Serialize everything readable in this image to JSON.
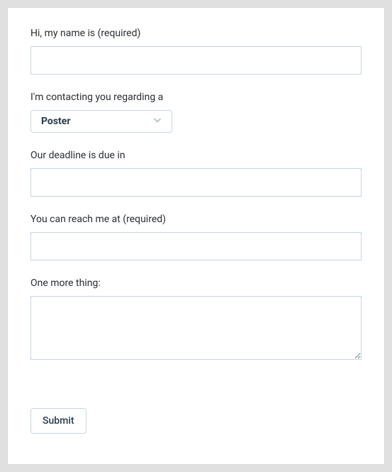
{
  "form": {
    "fields": {
      "name": {
        "label": "Hi, my name is (required)",
        "value": ""
      },
      "regarding": {
        "label": "I'm contacting you regarding a",
        "selected": "Poster"
      },
      "deadline": {
        "label": "Our deadline is due in",
        "value": ""
      },
      "contact": {
        "label": "You can reach me at (required)",
        "value": ""
      },
      "more": {
        "label": "One more thing:",
        "value": ""
      }
    },
    "submit_label": "Submit"
  }
}
